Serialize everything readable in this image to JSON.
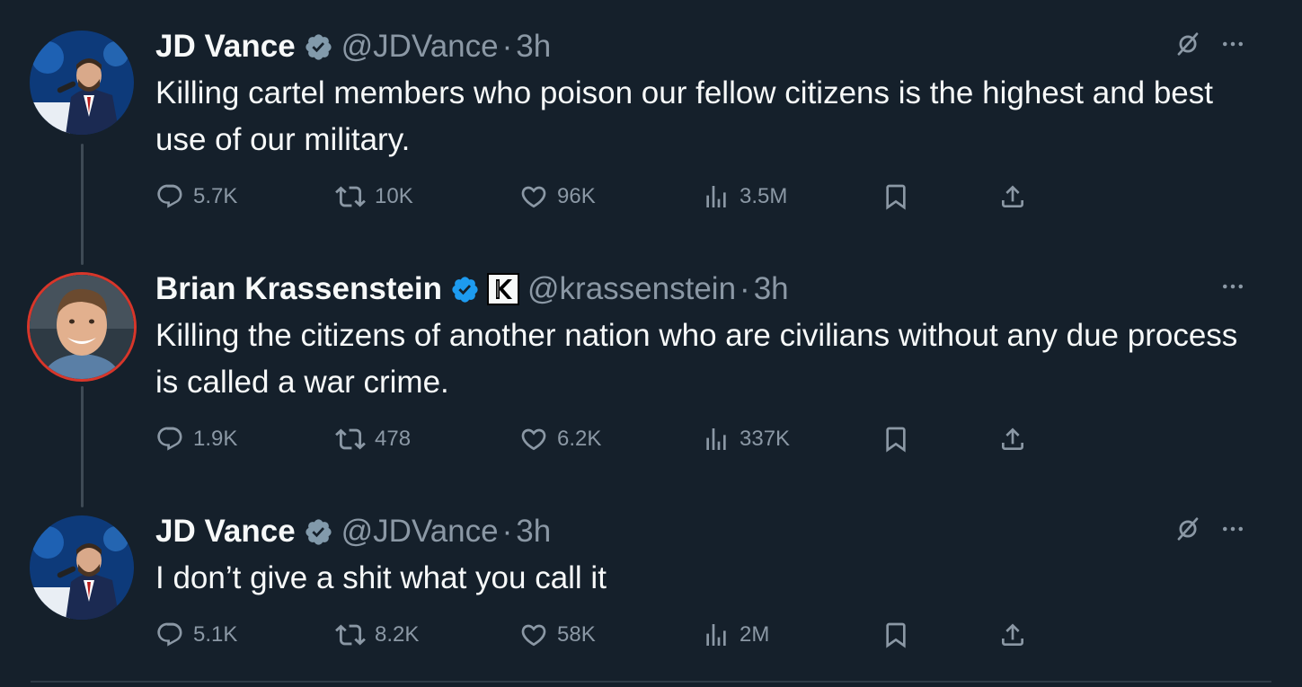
{
  "tweets": [
    {
      "name": "JD Vance",
      "handle": "@JDVance",
      "separator": "·",
      "time": "3h",
      "text": "Killing cartel members who poison our fellow citizens is the highest and best use of our military.",
      "verified": "gray-check",
      "stats": {
        "replies": "5.7K",
        "reposts": "10K",
        "likes": "96K",
        "views": "3.5M"
      }
    },
    {
      "name": "Brian Krassenstein",
      "handle": "@krassenstein",
      "separator": "·",
      "time": "3h",
      "text": "Killing the citizens of another nation who are civilians without any due process is called a war crime.",
      "verified": "blue-check",
      "affiliate_logo_text": "K",
      "stats": {
        "replies": "1.9K",
        "reposts": "478",
        "likes": "6.2K",
        "views": "337K"
      }
    },
    {
      "name": "JD Vance",
      "handle": "@JDVance",
      "separator": "·",
      "time": "3h",
      "text": "I don’t give a shit what you call it",
      "verified": "gray-check",
      "stats": {
        "replies": "5.1K",
        "reposts": "8.2K",
        "likes": "58K",
        "views": "2M"
      }
    }
  ],
  "icons": {
    "reply": "reply-icon",
    "repost": "repost-icon",
    "like": "heart-icon",
    "views": "views-icon",
    "bookmark": "bookmark-icon",
    "share": "share-icon",
    "more": "more-icon",
    "hide_replies": "hidden-reply-icon"
  },
  "colors": {
    "background": "#15202b",
    "text": "#f7f9f9",
    "secondary": "#8b98a5",
    "verified_blue": "#1d9bf0",
    "verified_gray": "#829aab",
    "thread_line": "#3e4a55"
  }
}
